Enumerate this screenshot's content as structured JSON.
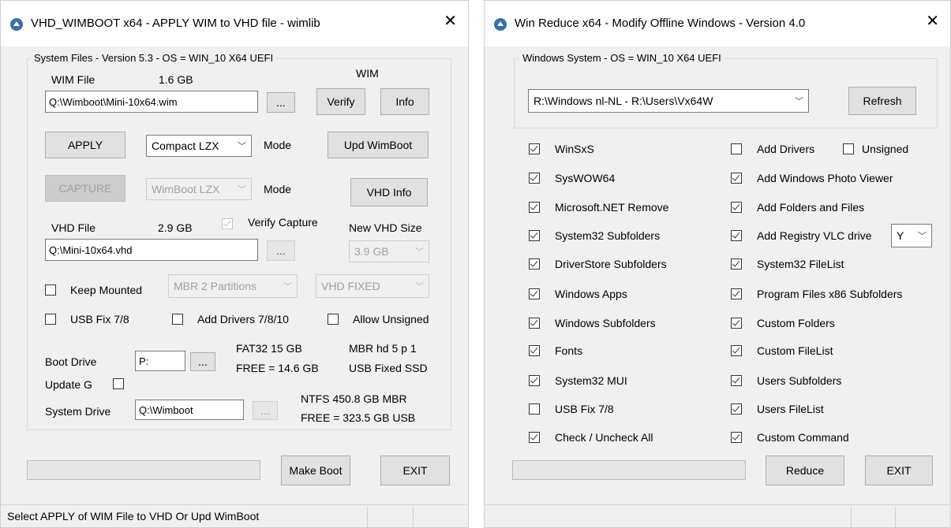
{
  "left": {
    "title": "VHD_WIMBOOT x64 - APPLY WIM to VHD file - wimlib",
    "group_legend": "System Files - Version 5.3  -  OS = WIN_10 X64  UEFI",
    "wim_label": "WIM File",
    "wim_size": "1.6 GB",
    "wim_heading": "WIM",
    "wim_path": "Q:\\Wimboot\\Mini-10x64.wim",
    "browse": "...",
    "verify": "Verify",
    "info": "Info",
    "apply": "APPLY",
    "apply_mode": "Compact LZX",
    "mode_label": "Mode",
    "upd_wimboot": "Upd WimBoot",
    "capture": "CAPTURE",
    "capture_mode": "WimBoot LZX",
    "mode_label2": "Mode",
    "vhd_info": "VHD Info",
    "vhd_label": "VHD File",
    "vhd_size": "2.9 GB",
    "verify_capture": "Verify Capture",
    "new_vhd_size_label": "New VHD Size",
    "vhd_path": "Q:\\Mini-10x64.vhd",
    "new_vhd_size": "3.9 GB",
    "keep_mounted": "Keep Mounted",
    "partitions": "MBR  2  Partitions",
    "vhd_type": "VHD    FIXED",
    "usb_fix": "USB Fix 7/8",
    "add_drivers": "Add Drivers 7/8/10",
    "allow_unsigned": "Allow Unsigned",
    "boot_drive_label": "Boot  Drive",
    "boot_drive": "P:",
    "boot_fs": "FAT32     15 GB",
    "boot_free": "FREE  = 14.6 GB",
    "boot_part": "MBR  hd 5  p 1",
    "boot_type": "USB  Fixed  SSD",
    "update_g": "Update G",
    "system_drive_label": "System Drive",
    "system_drive": "Q:\\Wimboot",
    "sys_fs": "NTFS      450.8 GB  MBR",
    "sys_free": "FREE  = 323.5 GB   USB",
    "make_boot": "Make Boot",
    "exit": "EXIT",
    "status": "Select APPLY of WIM File to VHD Or Upd WimBoot"
  },
  "right": {
    "title": "Win Reduce x64 - Modify Offline Windows - Version 4.0",
    "group_legend": "Windows System  -  OS = WIN_10 X64  UEFI",
    "system_select": "R:\\Windows nl-NL  -  R:\\Users\\Vx64W",
    "refresh": "Refresh",
    "col1": [
      {
        "label": "WinSxS",
        "checked": true
      },
      {
        "label": "SysWOW64",
        "checked": true
      },
      {
        "label": "Microsoft.NET Remove",
        "checked": true
      },
      {
        "label": "System32 Subfolders",
        "checked": true
      },
      {
        "label": "DriverStore Subfolders",
        "checked": true
      },
      {
        "label": "Windows Apps",
        "checked": true
      },
      {
        "label": "Windows Subfolders",
        "checked": true
      },
      {
        "label": "Fonts",
        "checked": true
      },
      {
        "label": "System32 MUI",
        "checked": true
      },
      {
        "label": "USB Fix 7/8",
        "checked": false
      },
      {
        "label": "Check / Uncheck All",
        "checked": true
      }
    ],
    "col2": [
      {
        "label": "Add Drivers",
        "checked": false
      },
      {
        "label": "Add Windows Photo Viewer",
        "checked": true
      },
      {
        "label": "Add Folders and Files",
        "checked": true
      },
      {
        "label": "Add Registry  VLC drive",
        "checked": true
      },
      {
        "label": "System32 FileList",
        "checked": true
      },
      {
        "label": "Program Files x86 Subfolders",
        "checked": true
      },
      {
        "label": "Custom Folders",
        "checked": true
      },
      {
        "label": "Custom FileList",
        "checked": true
      },
      {
        "label": "Users Subfolders",
        "checked": true
      },
      {
        "label": "Users FileList",
        "checked": true
      },
      {
        "label": "Custom Command",
        "checked": true
      }
    ],
    "unsigned": "Unsigned",
    "vlc_drive": "Y",
    "reduce": "Reduce",
    "exit": "EXIT"
  }
}
